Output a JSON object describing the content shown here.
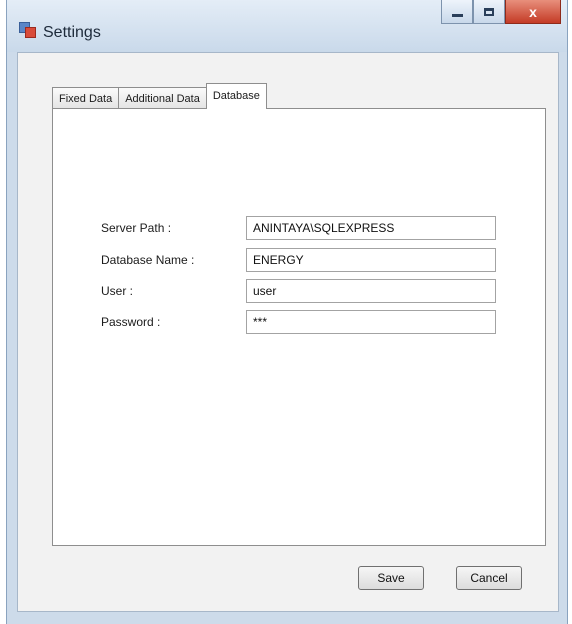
{
  "window": {
    "title": "Settings",
    "caption_buttons": {
      "minimize": "",
      "maximize": "",
      "close": "x"
    }
  },
  "tabs": [
    {
      "label": "Fixed Data",
      "active": false
    },
    {
      "label": "Additional Data",
      "active": false
    },
    {
      "label": "Database",
      "active": true
    }
  ],
  "database": {
    "server_path": {
      "label": "Server Path :",
      "value": "ANINTAYA\\SQLEXPRESS"
    },
    "database_name": {
      "label": "Database Name :",
      "value": "ENERGY"
    },
    "user": {
      "label": "User :",
      "value": "user"
    },
    "password": {
      "label": "Password :",
      "value": "***"
    }
  },
  "buttons": {
    "save": "Save",
    "cancel": "Cancel"
  },
  "icons": {
    "app": "settings-app-icon"
  }
}
